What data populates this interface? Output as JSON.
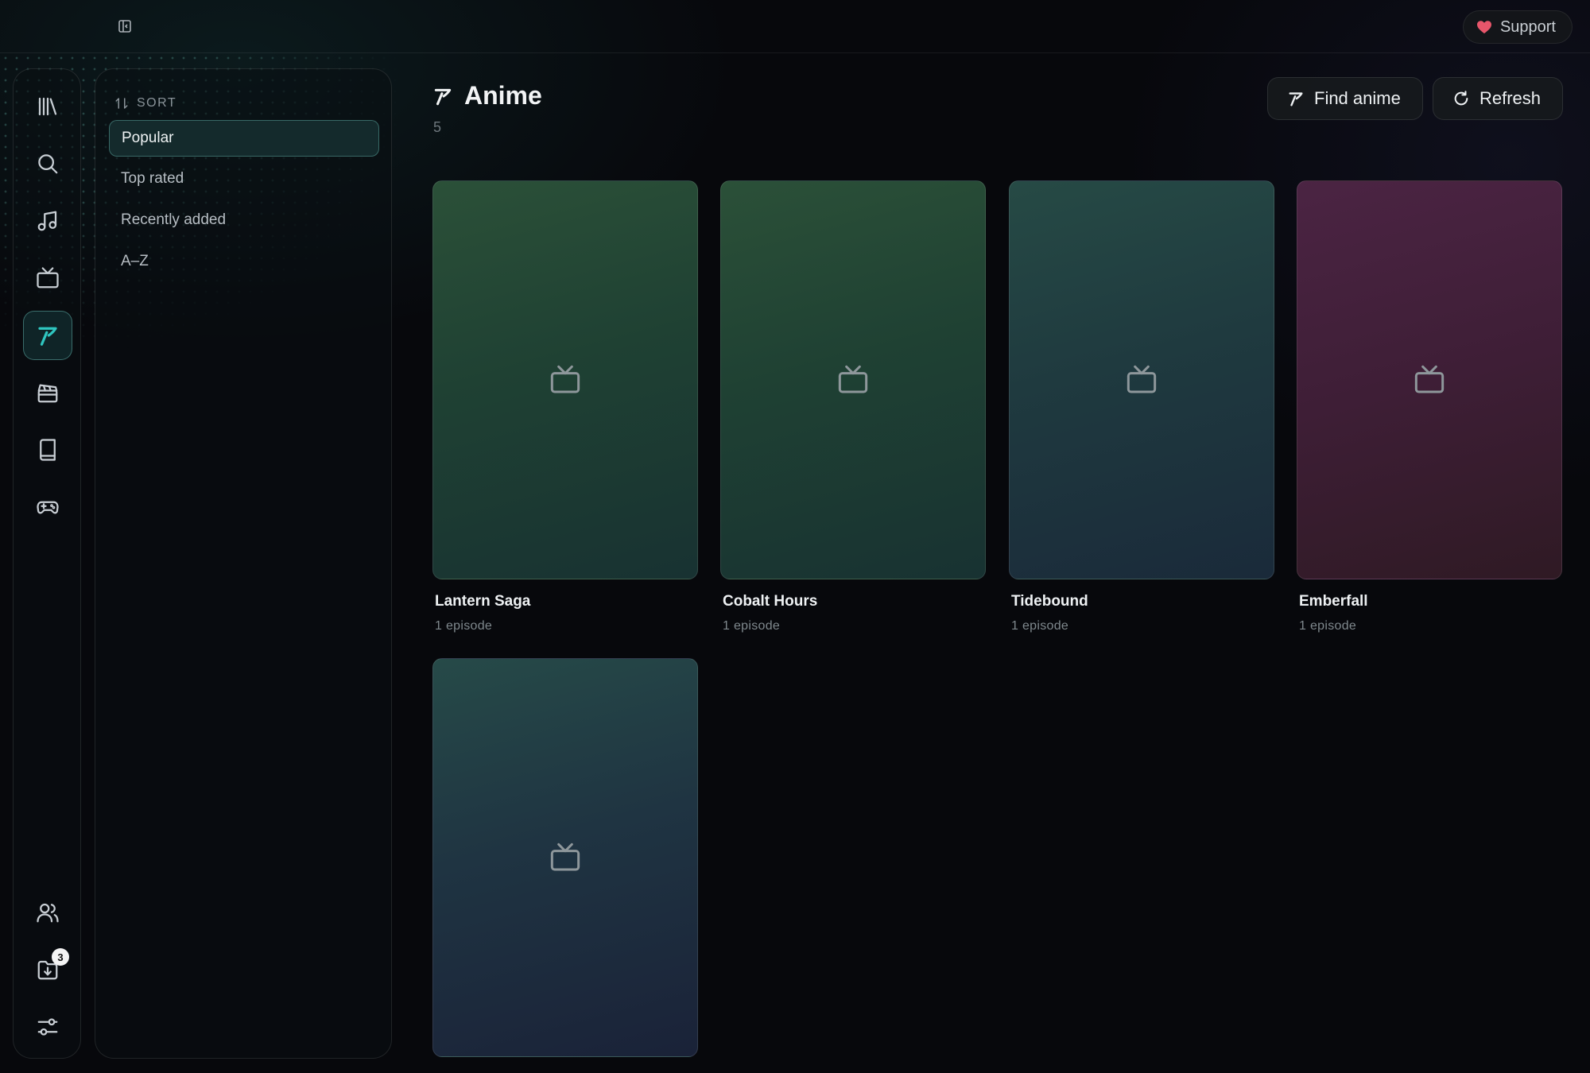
{
  "topbar": {
    "support_label": "Support"
  },
  "rail": {
    "items": [
      {
        "icon": "library-icon"
      },
      {
        "icon": "search-icon"
      },
      {
        "icon": "music-icon"
      },
      {
        "icon": "tv-icon"
      },
      {
        "icon": "anime-icon",
        "active": true
      },
      {
        "icon": "movie-clapper-icon"
      },
      {
        "icon": "book-icon"
      },
      {
        "icon": "gamepad-icon"
      },
      {
        "icon": "users-icon"
      },
      {
        "icon": "downloads-icon",
        "badge": "3"
      },
      {
        "icon": "settings-sliders-icon"
      }
    ],
    "downloads_badge": "3"
  },
  "sort": {
    "heading": "SORT",
    "options": [
      {
        "label": "Popular",
        "selected": true
      },
      {
        "label": "Top rated"
      },
      {
        "label": "Recently added"
      },
      {
        "label": "A–Z"
      }
    ]
  },
  "header": {
    "title": "Anime",
    "count": "5",
    "find_label": "Find anime",
    "refresh_label": "Refresh"
  },
  "cards": [
    {
      "title": "Lantern Saga",
      "subtitle": "1 episode"
    },
    {
      "title": "Cobalt Hours",
      "subtitle": "1 episode"
    },
    {
      "title": "Tidebound",
      "subtitle": "1 episode"
    },
    {
      "title": "Emberfall",
      "subtitle": "1 episode"
    },
    {
      "title": "",
      "subtitle": ""
    }
  ],
  "colors": {
    "accent": "#2fc6c0",
    "support_heart": "#e8566b",
    "background": "#07080c"
  }
}
